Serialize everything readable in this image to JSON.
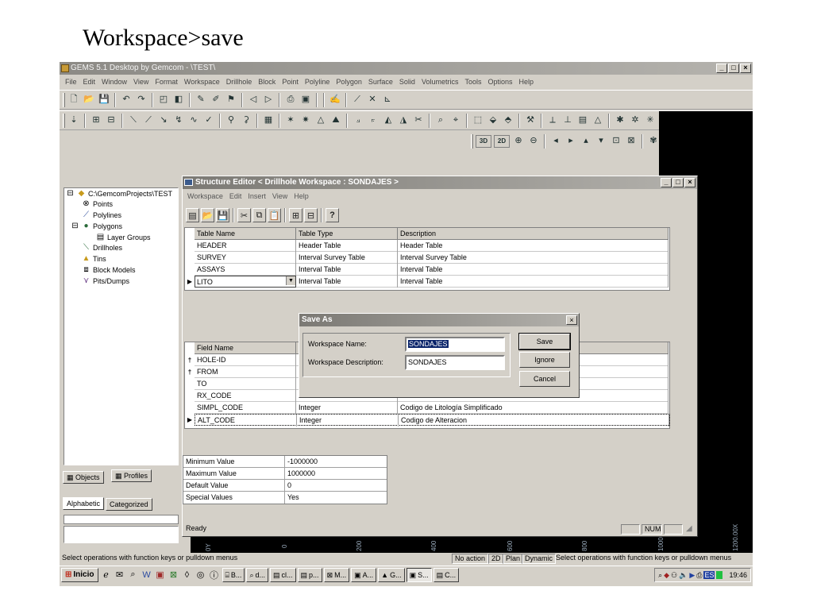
{
  "slide": {
    "title": "Workspace>save"
  },
  "window": {
    "title": "GEMS 5.1 Desktop by Gemcom - \\TEST\\",
    "min": "_",
    "max": "□",
    "close": "×"
  },
  "menu": [
    "File",
    "Edit",
    "Window",
    "View",
    "Format",
    "Workspace",
    "Drillhole",
    "Block",
    "Point",
    "Polyline",
    "Polygon",
    "Surface",
    "Solid",
    "Volumetrics",
    "Tools",
    "Options",
    "Help"
  ],
  "toolbar": {
    "view3d": "3D",
    "view2d": "2D"
  },
  "tree": {
    "root": "C:\\GemcomProjects\\TEST",
    "items": [
      "Points",
      "Polylines",
      "Polygons",
      "Layer Groups",
      "Drillholes",
      "Tins",
      "Block Models",
      "Pits/Dumps"
    ]
  },
  "panel_tabs": {
    "objects": "Objects",
    "profiles": "Profiles",
    "alphabetic": "Alphabetic",
    "categorized": "Categorized"
  },
  "structure_editor": {
    "title": "Structure Editor < Drillhole Workspace : SONDAJES >",
    "menu": [
      "Workspace",
      "Edit",
      "Insert",
      "View",
      "Help"
    ],
    "tables_header": [
      "Table Name",
      "Table Type",
      "Description"
    ],
    "tables": [
      [
        "HEADER",
        "Header Table",
        "Header Table"
      ],
      [
        "SURVEY",
        "Interval Survey Table",
        "Interval Survey Table"
      ],
      [
        "ASSAYS",
        "Interval Table",
        "Interval Table"
      ],
      [
        "LITO",
        "Interval Table",
        "Interval Table"
      ]
    ],
    "fields_header": "Field Name",
    "fields": [
      [
        "HOLE-ID",
        "",
        ""
      ],
      [
        "FROM",
        "",
        ""
      ],
      [
        "TO",
        "",
        ""
      ],
      [
        "RX_CODE",
        "",
        ""
      ],
      [
        "SIMPL_CODE",
        "Integer",
        "Codigo de Litología Simplificado"
      ],
      [
        "ALT_CODE",
        "Integer",
        "Codigo de Alteracion"
      ]
    ],
    "status": "Ready",
    "num": "NUM"
  },
  "properties": [
    [
      "Minimum Value",
      "-1000000"
    ],
    [
      "Maximum Value",
      "1000000"
    ],
    [
      "Default Value",
      "0"
    ],
    [
      "Special Values",
      "Yes"
    ]
  ],
  "save_dialog": {
    "title": "Save As",
    "name_label": "Workspace Name:",
    "name_value": "SONDAJES",
    "desc_label": "Workspace Description:",
    "desc_value": "SONDAJES",
    "save": "Save",
    "ignore": "Ignore",
    "cancel": "Cancel"
  },
  "axis_labels": [
    "0Y",
    "0",
    "200",
    "400",
    "600",
    "800",
    "1000",
    "1200.00X"
  ],
  "main_status": {
    "left": "Select operations with function keys or pulldown menus",
    "action": "No action",
    "mode2d": "2D",
    "plan": "Plan",
    "dynamic": "Dynamic",
    "right": "Select operations with function keys or pulldown menus"
  },
  "taskbar": {
    "start": "Inicio",
    "buttons": [
      "B...",
      "d...",
      "cl...",
      "p...",
      "M...",
      "A...",
      "G...",
      "S...",
      "C..."
    ],
    "active_index": 7,
    "lang": "ES",
    "clock": "19:46"
  },
  "colors": {
    "titlebar": "#8c8a85",
    "selection": "#0a246a",
    "face": "#d4d0c8"
  }
}
